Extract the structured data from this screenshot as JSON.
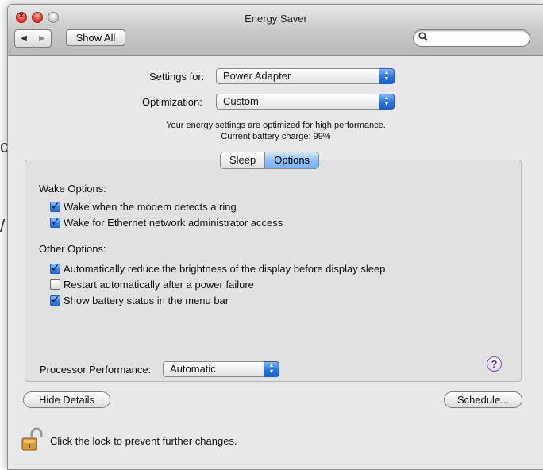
{
  "window": {
    "title": "Energy Saver"
  },
  "toolbar": {
    "back_icon": "back-arrow-icon",
    "forward_icon": "forward-arrow-icon",
    "show_all_label": "Show All",
    "search_placeholder": ""
  },
  "settings_for": {
    "label": "Settings for:",
    "value": "Power Adapter"
  },
  "optimization": {
    "label": "Optimization:",
    "value": "Custom"
  },
  "status": {
    "line1": "Your energy settings are optimized for high performance.",
    "line2": "Current battery charge: 99%"
  },
  "tabs": [
    {
      "label": "Sleep",
      "active": false
    },
    {
      "label": "Options",
      "active": true
    }
  ],
  "wake_options": {
    "title": "Wake Options:",
    "items": [
      {
        "label": "Wake when the modem detects a ring",
        "checked": true
      },
      {
        "label": "Wake for Ethernet network administrator access",
        "checked": true
      }
    ]
  },
  "other_options": {
    "title": "Other Options:",
    "items": [
      {
        "label": "Automatically reduce the brightness of the display before display sleep",
        "checked": true
      },
      {
        "label": "Restart automatically after a power failure",
        "checked": false
      },
      {
        "label": "Show battery status in the menu bar",
        "checked": true
      }
    ]
  },
  "processor": {
    "label": "Processor Performance:",
    "value": "Automatic"
  },
  "help": {
    "symbol": "?"
  },
  "buttons": {
    "hide_details": "Hide Details",
    "schedule": "Schedule..."
  },
  "lock": {
    "text": "Click the lock to prevent further changes."
  },
  "colors": {
    "selection_blue": "#3b85e4",
    "window_bg": "#e8e8e8",
    "tab_active": "#8fc1f7"
  }
}
